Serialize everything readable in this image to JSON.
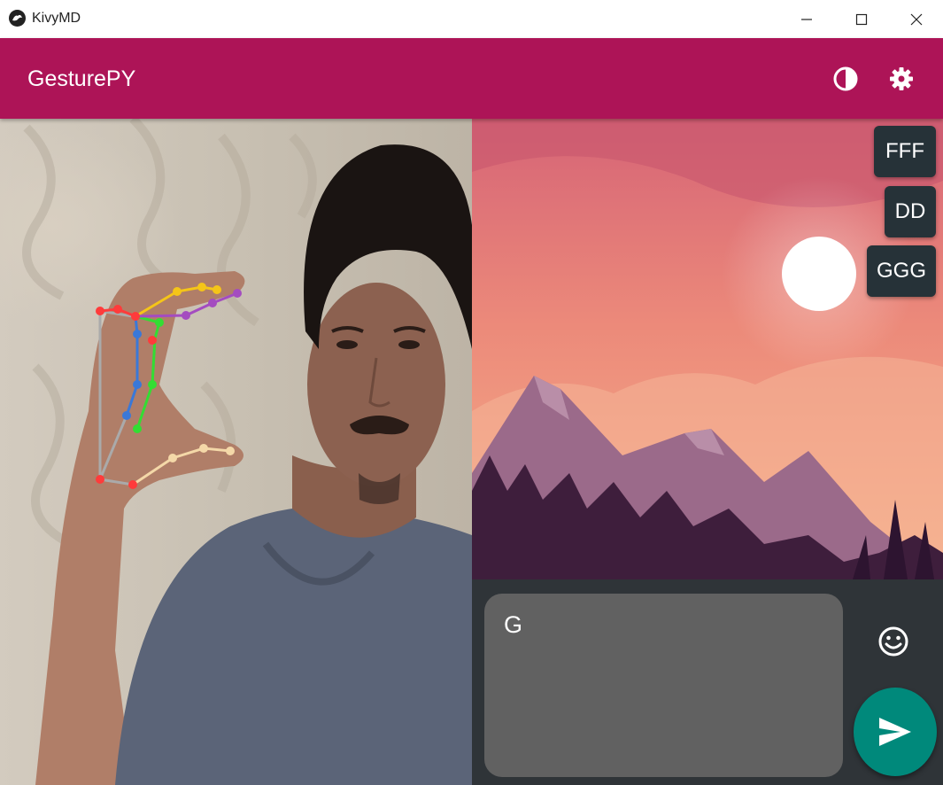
{
  "window": {
    "title": "KivyMD"
  },
  "appbar": {
    "title": "GesturePY",
    "actions": [
      "theme-toggle-icon",
      "settings-gear-icon"
    ]
  },
  "suggestions": [
    "FFF",
    "DD",
    "GGG"
  ],
  "input": {
    "value": "G"
  },
  "colors": {
    "appbar": "#ad1457",
    "chip": "#263238",
    "input_bg": "#616161",
    "fab": "#00897b",
    "panel": "#2f3438"
  }
}
